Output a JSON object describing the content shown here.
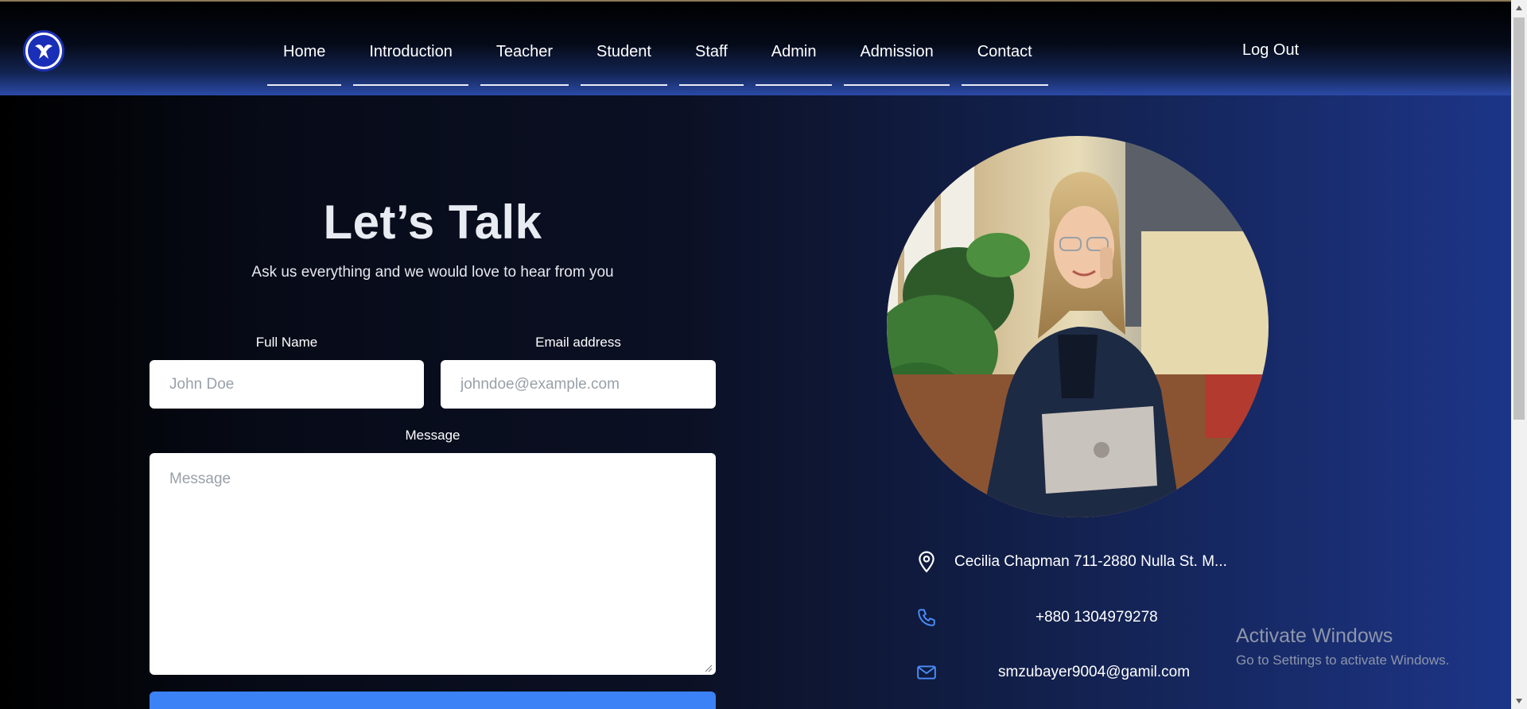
{
  "nav": {
    "items": [
      {
        "label": "Home"
      },
      {
        "label": "Introduction"
      },
      {
        "label": "Teacher"
      },
      {
        "label": "Student"
      },
      {
        "label": "Staff"
      },
      {
        "label": "Admin"
      },
      {
        "label": "Admission"
      },
      {
        "label": "Contact"
      }
    ],
    "logout_label": "Log Out"
  },
  "form": {
    "title": "Let’s Talk",
    "subtitle": "Ask us everything and we would love to hear from you",
    "full_name_label": "Full Name",
    "full_name_placeholder": "John Doe",
    "email_label": "Email address",
    "email_placeholder": "johndoe@example.com",
    "message_label": "Message",
    "message_placeholder": "Message"
  },
  "contact": {
    "address": "Cecilia Chapman 711-2880 Nulla St. M...",
    "phone": "+880 1304979278",
    "email": "smzubayer9004@gamil.com"
  },
  "watermark": {
    "title": "Activate Windows",
    "subtitle": "Go to Settings to activate Windows."
  },
  "colors": {
    "accent": "#3b82f6",
    "nav_gradient_bottom": "#2b4aa8",
    "icon_blue": "#4a8df8"
  },
  "icons": {
    "logo": "eagle-logo-icon",
    "address": "map-pin-icon",
    "phone": "phone-icon",
    "email": "mail-icon"
  }
}
